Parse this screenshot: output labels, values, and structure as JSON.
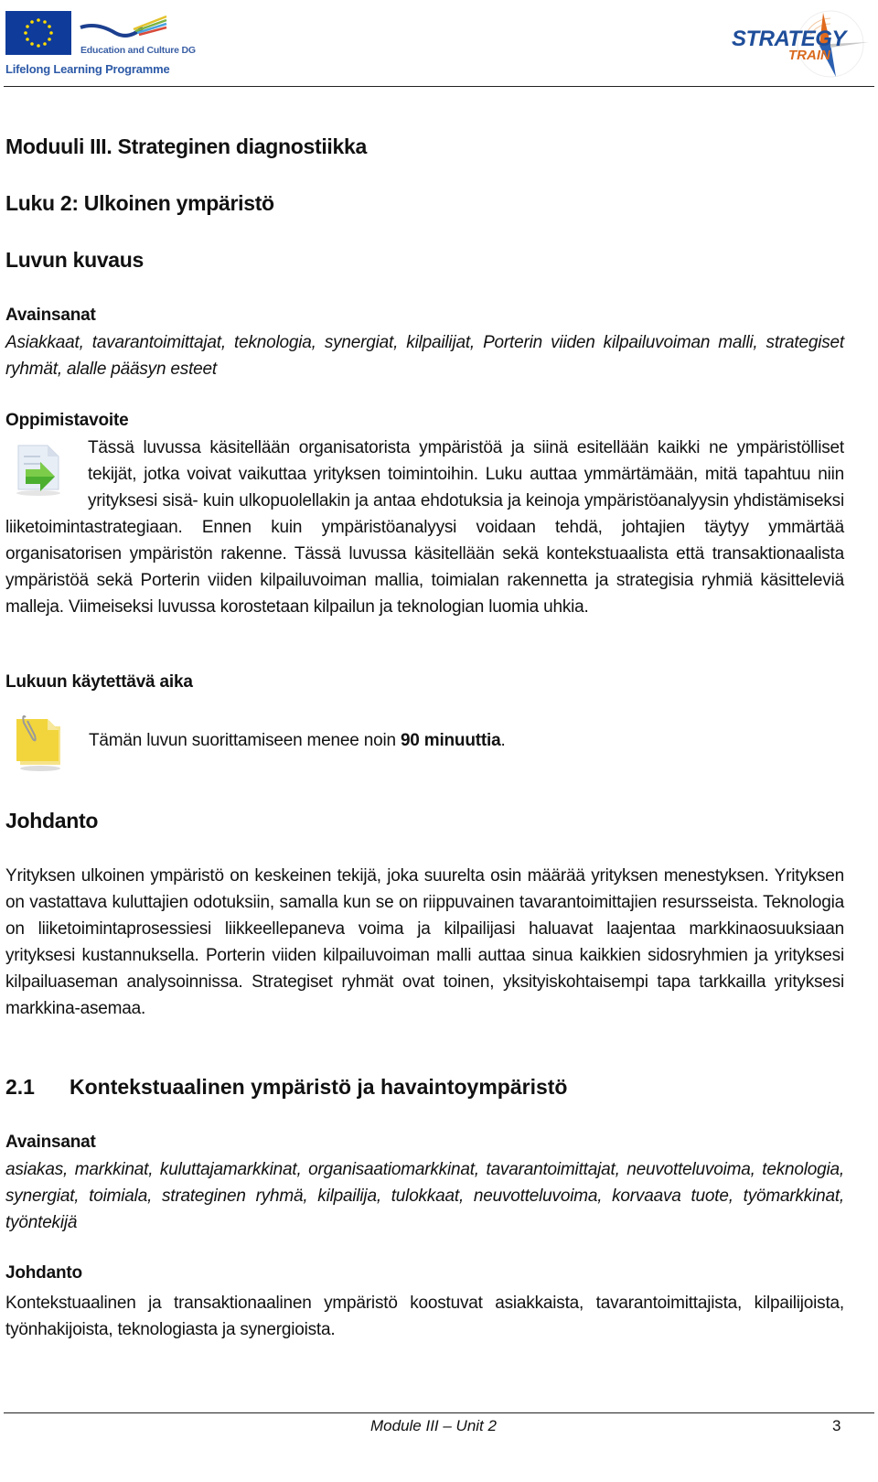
{
  "header": {
    "left_logo": {
      "icon": "eu-flag-icon",
      "dg_text": "Education and Culture DG",
      "programme_text": "Lifelong Learning Programme"
    },
    "right_logo": {
      "icon": "strategy-train-compass-icon",
      "word1": "STRATEGY",
      "word2": "TRAIN",
      "colors": {
        "blue": "#1f4e9a",
        "orange": "#d96a1e"
      }
    }
  },
  "document": {
    "module_title": "Moduuli III. Strateginen diagnostiikka",
    "chapter_title": "Luku 2: Ulkoinen ympäristö",
    "description_heading": "Luvun kuvaus",
    "keywords_heading": "Avainsanat",
    "keywords_text": "Asiakkaat, tavarantoimittajat, teknologia, synergiat, kilpailijat, Porterin viiden kilpailuvoiman malli, strategiset ryhmät, alalle pääsyn esteet",
    "objective_heading": "Oppimistavoite",
    "objective_icon": "document-arrow-icon",
    "objective_text": "Tässä luvussa käsitellään organisatorista ympäristöä ja siinä esitellään kaikki ne ympäristölliset tekijät, jotka voivat vaikuttaa yrityksen toimintoihin. Luku auttaa ymmärtämään, mitä tapahtuu niin yrityksesi sisä- kuin ulkopuolellakin ja antaa ehdotuksia ja keinoja ympäristöanalyysin yhdistämiseksi liiketoimintastrategiaan. Ennen kuin ympäristöanalyysi voidaan tehdä, johtajien täytyy ymmärtää organisatorisen ympäristön rakenne. Tässä luvussa käsitellään sekä kontekstuaalista että transaktionaalista ympäristöä sekä Porterin viiden kilpailuvoiman mallia, toimialan rakennetta ja strategisia ryhmiä käsitteleviä malleja. Viimeiseksi luvussa korostetaan kilpailun ja teknologian luomia uhkia.",
    "time_heading": "Lukuun käytettävä aika",
    "time_icon": "note-paperclip-icon",
    "time_text_prefix": "Tämän luvun suorittamiseen menee noin ",
    "time_text_bold": "90 minuuttia",
    "time_text_suffix": ".",
    "intro_heading": "Johdanto",
    "intro_text": "Yrityksen ulkoinen ympäristö on keskeinen tekijä, joka suurelta osin määrää yrityksen menestyksen. Yrityksen on vastattava kuluttajien odotuksiin, samalla kun se on riippuvainen tavarantoimittajien resursseista. Teknologia on liiketoimintaprosessiesi liikkeellepaneva voima ja kilpailijasi haluavat laajentaa markkinaosuuksiaan yrityksesi kustannuksella. Porterin viiden kilpailuvoiman malli auttaa sinua kaikkien sidosryhmien ja yrityksesi kilpailuaseman analysoinnissa. Strategiset ryhmät ovat toinen, yksityiskohtaisempi tapa tarkkailla yrityksesi markkina-asemaa.",
    "section": {
      "number": "2.1",
      "title": "Kontekstuaalinen ympäristö ja havaintoympäristö",
      "keywords_heading": "Avainsanat",
      "keywords_text": "asiakas, markkinat, kuluttajamarkkinat, organisaatiomarkkinat, tavarantoimittajat, neuvotteluvoima, teknologia, synergiat, toimiala, strateginen ryhmä, kilpailija, tulokkaat, neuvotteluvoima, korvaava tuote, työmarkkinat, työntekijä",
      "intro_heading": "Johdanto",
      "intro_text": "Kontekstuaalinen ja transaktionaalinen ympäristö koostuvat asiakkaista, tavarantoimittajista, kilpailijoista, työnhakijoista, teknologiasta ja synergioista."
    }
  },
  "footer": {
    "label": "Module III – Unit 2",
    "page_number": "3"
  }
}
